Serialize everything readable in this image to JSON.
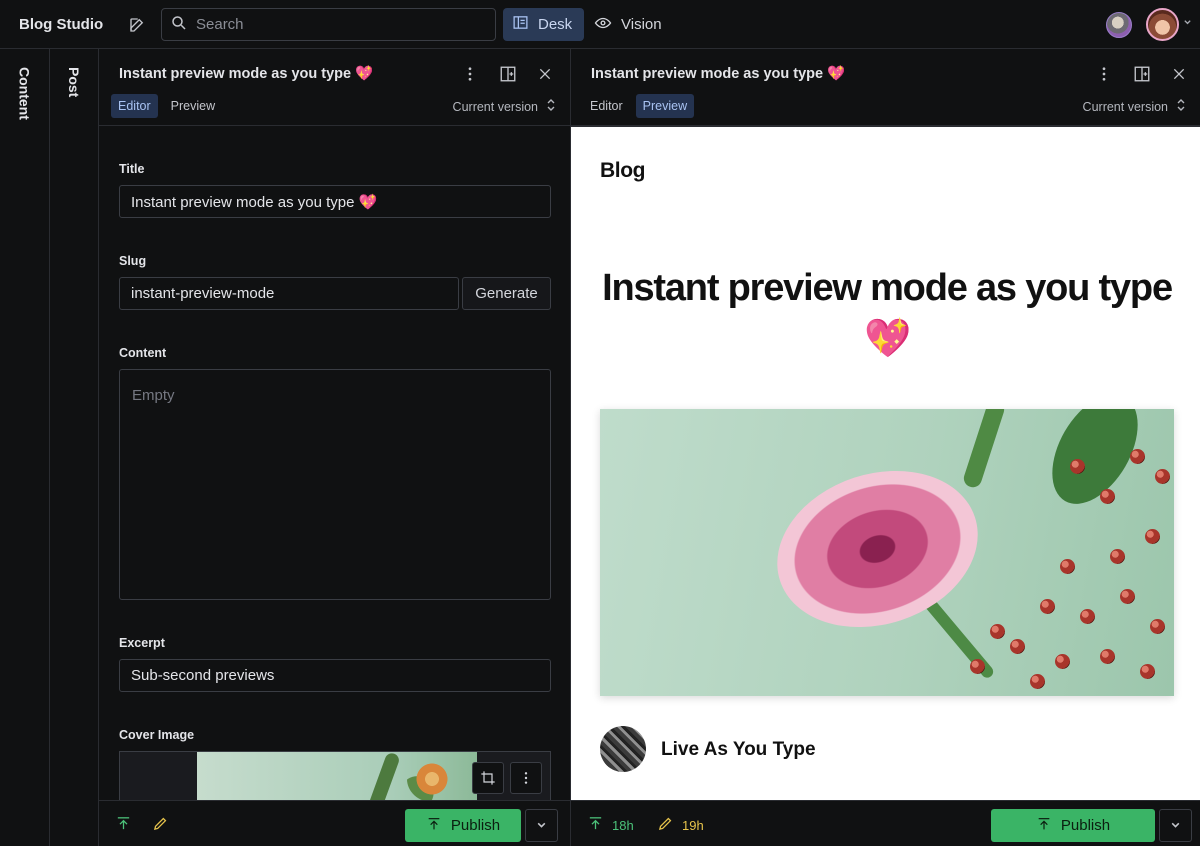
{
  "app": {
    "brand": "Blog Studio",
    "search_placeholder": "Search",
    "tools": {
      "desk": "Desk",
      "vision": "Vision"
    }
  },
  "rails": {
    "content": "Content",
    "post": "Post"
  },
  "editor_pane": {
    "title": "Instant preview mode as you type 💖",
    "tabs": {
      "editor": "Editor",
      "preview": "Preview"
    },
    "active_tab": "editor",
    "version": "Current version",
    "fields": {
      "title_label": "Title",
      "title_value": "Instant preview mode as you type 💖",
      "slug_label": "Slug",
      "slug_value": "instant-preview-mode",
      "generate_label": "Generate",
      "content_label": "Content",
      "content_placeholder": "Empty",
      "excerpt_label": "Excerpt",
      "excerpt_value": "Sub-second previews",
      "cover_label": "Cover Image"
    },
    "footer": {
      "publish_label": "Publish"
    }
  },
  "preview_pane": {
    "title": "Instant preview mode as you type 💖",
    "tabs": {
      "editor": "Editor",
      "preview": "Preview"
    },
    "active_tab": "preview",
    "version": "Current version",
    "body": {
      "blog_heading": "Blog",
      "post_title": "Instant preview mode as you type 💖",
      "author_name": "Live As You Type"
    },
    "footer": {
      "published_ago": "18h",
      "edited_ago": "19h",
      "publish_label": "Publish"
    }
  },
  "colors": {
    "background": "#101112",
    "accent_active": "#243350",
    "publish_green": "#3ab466",
    "published_icon": "#4cc27a",
    "edit_icon": "#e7c44c"
  }
}
